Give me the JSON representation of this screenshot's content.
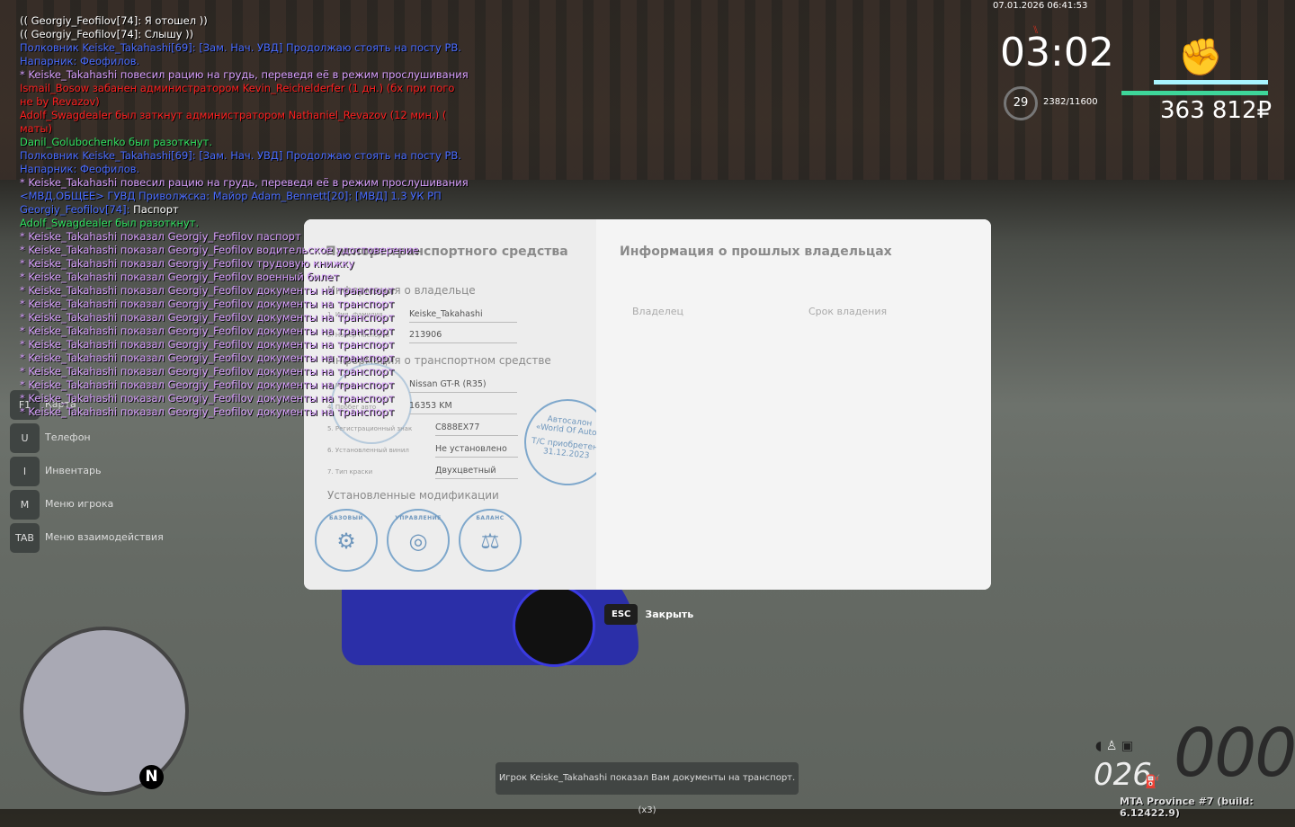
{
  "chat": [
    {
      "c": "#ffffff",
      "t": "(( Georgiy_Feofilov[74]: Я отошел ))"
    },
    {
      "c": "#ffffff",
      "t": "(( Georgiy_Feofilov[74]: Слышу ))"
    },
    {
      "c": "#4a6cff",
      "t": "Полковник Keiske_Takahashi[69]: [Зам. Нач. УВД] Продолжаю стоять на посту РВ."
    },
    {
      "c": "#4a6cff",
      "t": " Напарник: Феофилов."
    },
    {
      "c": "#d9a0ff",
      "t": "* Keiske_Takahashi повесил рацию на грудь, переведя её в режим прослушивания"
    },
    {
      "c": "#ff2020",
      "t": "Ismail_Bosow забанен администратором Kevin_Reichelderfer (1 дн.) (бх при пого"
    },
    {
      "c": "#ff2020",
      "t": "не by Revazov)"
    },
    {
      "c": "#ff2020",
      "t": "Adolf_Swagdealer был заткнут администратором Nathaniel_Revazov (12 мин.) ("
    },
    {
      "c": "#ff2020",
      "t": "маты)"
    },
    {
      "c": "#30e060",
      "t": "Danil_Golubochenko был разоткнут."
    },
    {
      "c": "#4a6cff",
      "t": "Полковник Keiske_Takahashi[69]: [Зам. Нач. УВД] Продолжаю стоять на посту РВ."
    },
    {
      "c": "#4a6cff",
      "t": " Напарник: Феофилов."
    },
    {
      "c": "#d9a0ff",
      "t": "* Keiske_Takahashi повесил рацию на грудь, переведя её в режим прослушивания"
    },
    {
      "c": "#4a6cff",
      "t": "<МВД.ОБЩЕЕ> ГУВД Приволжска: Майор Adam_Bennett[20]: [МВД] 1.3 УК РП"
    },
    {
      "c": "#4a6cff",
      "t": "Georgiy_Feofilov[74]:",
      "t2": " Паспорт"
    },
    {
      "c": "#30e060",
      "t": "Adolf_Swagdealer был разоткнут."
    },
    {
      "c": "#d9a0ff",
      "t": "* Keiske_Takahashi показал Georgiy_Feofilov паспорт"
    },
    {
      "c": "#d9a0ff",
      "t": "* Keiske_Takahashi показал Georgiy_Feofilov водительское удостоверение"
    },
    {
      "c": "#d9a0ff",
      "t": "* Keiske_Takahashi показал Georgiy_Feofilov трудовую книжку"
    },
    {
      "c": "#d9a0ff",
      "t": "* Keiske_Takahashi показал Georgiy_Feofilov военный билет"
    },
    {
      "c": "#d9a0ff",
      "t": "* Keiske_Takahashi показал Georgiy_Feofilov документы на транспорт"
    },
    {
      "c": "#d9a0ff",
      "t": "* Keiske_Takahashi показал Georgiy_Feofilov документы на транспорт"
    },
    {
      "c": "#d9a0ff",
      "t": "* Keiske_Takahashi показал Georgiy_Feofilov документы на транспорт"
    },
    {
      "c": "#d9a0ff",
      "t": "* Keiske_Takahashi показал Georgiy_Feofilov документы на транспорт"
    },
    {
      "c": "#d9a0ff",
      "t": "* Keiske_Takahashi показал Georgiy_Feofilov документы на транспорт"
    },
    {
      "c": "#d9a0ff",
      "t": "* Keiske_Takahashi показал Georgiy_Feofilov документы на транспорт"
    },
    {
      "c": "#d9a0ff",
      "t": "* Keiske_Takahashi показал Georgiy_Feofilov документы на транспорт"
    },
    {
      "c": "#d9a0ff",
      "t": "* Keiske_Takahashi показал Georgiy_Feofilov документы на транспорт"
    },
    {
      "c": "#d9a0ff",
      "t": "* Keiske_Takahashi показал Georgiy_Feofilov документы на транспорт"
    },
    {
      "c": "#d9a0ff",
      "t": "* Keiske_Takahashi показал Georgiy_Feofilov документы на транспорт"
    }
  ],
  "doc": {
    "title": "Паспорт транспортного средства",
    "owner_section": "Информация о владельце",
    "fields_owner": [
      {
        "label": "1. Имя, фамилия",
        "value": "Keiske_Takahashi"
      },
      {
        "label": "2. Номер паспорта",
        "value": "213906"
      }
    ],
    "vehicle_section": "Информация о транспортном средстве",
    "fields_vehicle": [
      {
        "label": "3. Марка",
        "value": "Nissan GT-R (R35)"
      },
      {
        "label": "4. Пробег авто",
        "value": "16353 KM"
      },
      {
        "label": "5. Регистрационный знак",
        "value": "С888ЕХ77"
      },
      {
        "label": "6. Установленный винил",
        "value": "Не установлено"
      },
      {
        "label": "7. Тип краски",
        "value": "Двухцветный"
      }
    ],
    "stamp_dealer": {
      "line1": "Автосалон",
      "line2": "«World Of Auto»",
      "line3": "Т/С приобретено",
      "date": "31.12.2023"
    },
    "mods_title": "Установленные модификации",
    "mods": [
      "БАЗОВЫЙ",
      "УПРАВЛЕНИЕ",
      "БАЛАНС"
    ],
    "owners_title": "Информация о прошлых владельцах",
    "col_owner": "Владелец",
    "col_period": "Срок владения"
  },
  "close": {
    "key": "ESC",
    "label": "Закрыть"
  },
  "keys": [
    {
      "k": "F1",
      "l": "Карта"
    },
    {
      "k": "U",
      "l": "Телефон"
    },
    {
      "k": "I",
      "l": "Инвентарь"
    },
    {
      "k": "M",
      "l": "Меню игрока"
    },
    {
      "k": "TAB",
      "l": "Меню взаимодействия"
    }
  ],
  "hud": {
    "datetime": "07.01.2026 06:41:53",
    "time": "03:02",
    "level": "29",
    "xp": "2382/11600",
    "money": "363 812₽",
    "health": 1.0,
    "armor": 1.0
  },
  "speedo": {
    "fuel": "026",
    "speed": "000"
  },
  "notification": "Игрок Keiske_Takahashi показал Вам документы на транспорт. (x3)",
  "build": "MTA Province #7 (build: 6.12422.9)",
  "minimap": {
    "north": "N"
  }
}
